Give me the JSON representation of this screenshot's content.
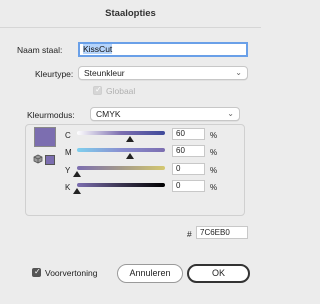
{
  "dialog": {
    "title": "Staalopties"
  },
  "name_field": {
    "label": "Naam staal:",
    "value": "KissCut"
  },
  "color_type": {
    "label": "Kleurtype:",
    "value": "Steunkleur"
  },
  "global": {
    "label": "Globaal",
    "checked": true,
    "disabled": true
  },
  "color_mode": {
    "label": "Kleurmodus:",
    "value": "CMYK"
  },
  "swatch_color": "#7C6EB0",
  "sliders": [
    {
      "label": "C",
      "value": "60",
      "unit": "%",
      "fraction": 0.6,
      "gradient": "linear-gradient(to right, #ffffff, #7c6eb0, #3f4a9a)"
    },
    {
      "label": "M",
      "value": "60",
      "unit": "%",
      "fraction": 0.6,
      "gradient": "linear-gradient(to right, #7fd0ee, #8a8fd0, #7c6eb0)"
    },
    {
      "label": "Y",
      "value": "0",
      "unit": "%",
      "fraction": 0.0,
      "gradient": "linear-gradient(to right, #7c6eb0, #a49a8a, #d4c870)"
    },
    {
      "label": "K",
      "value": "0",
      "unit": "%",
      "fraction": 0.0,
      "gradient": "linear-gradient(to right, #7c6eb0, #3a3450, #000000)"
    }
  ],
  "hex": {
    "symbol": "#",
    "value": "7C6EB0"
  },
  "preview": {
    "label": "Voorvertoning",
    "checked": true
  },
  "buttons": {
    "cancel": "Annuleren",
    "ok": "OK"
  }
}
